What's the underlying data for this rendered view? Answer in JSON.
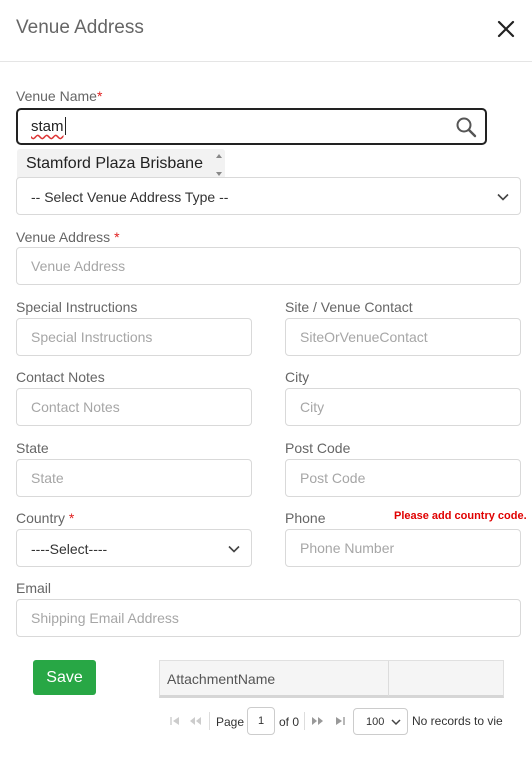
{
  "dialog": {
    "title": "Venue Address"
  },
  "venue_name": {
    "label": "Venue Name",
    "required_mark": "*",
    "value": "stam",
    "suggestion": "Stamford Plaza Brisbane"
  },
  "address_type": {
    "selected": "-- Select Venue Address Type --"
  },
  "venue_address": {
    "label": "Venue Address",
    "required_mark": "*",
    "placeholder": "Venue Address"
  },
  "special_instructions": {
    "label": "Special Instructions",
    "placeholder": "Special Instructions"
  },
  "site_contact": {
    "label": "Site / Venue Contact",
    "placeholder": "SiteOrVenueContact"
  },
  "contact_notes": {
    "label": "Contact Notes",
    "placeholder": "Contact Notes"
  },
  "city": {
    "label": "City",
    "placeholder": "City"
  },
  "state": {
    "label": "State",
    "placeholder": "State"
  },
  "post_code": {
    "label": "Post Code",
    "placeholder": "Post Code"
  },
  "country": {
    "label": "Country",
    "required_mark": "*",
    "selected": "----Select----"
  },
  "phone": {
    "label": "Phone",
    "note": "Please add country code.",
    "placeholder": "Phone Number"
  },
  "email": {
    "label": "Email",
    "placeholder": "Shipping Email Address"
  },
  "actions": {
    "save_label": "Save"
  },
  "attachments": {
    "column_header": "AttachmentName"
  },
  "pager": {
    "page_label": "Page",
    "page_value": "1",
    "of_label": "of 0",
    "per_page": "100",
    "status": "No records to vie"
  },
  "colors": {
    "save_button": "#28a745",
    "required_mark": "#e02020",
    "note": "#e00000"
  },
  "icons": [
    "close-icon",
    "search-icon",
    "chevron-down-icon",
    "first-page-icon",
    "prev-page-icon",
    "next-page-icon",
    "last-page-icon"
  ]
}
